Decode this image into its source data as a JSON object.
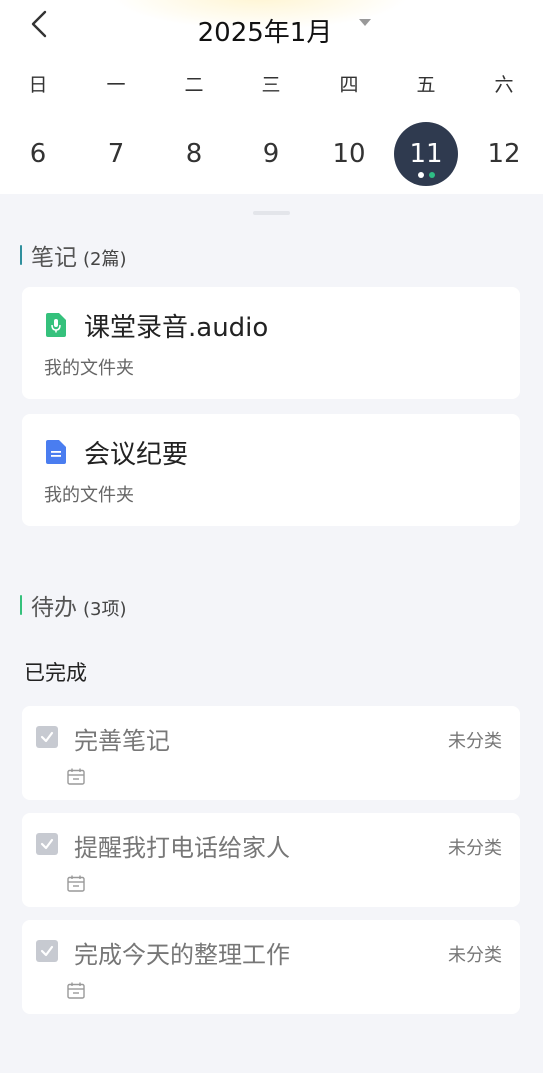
{
  "header": {
    "month_title": "2025年1月",
    "weekdays": [
      "日",
      "一",
      "二",
      "三",
      "四",
      "五",
      "六"
    ],
    "dates": [
      "6",
      "7",
      "8",
      "9",
      "10",
      "11",
      "12"
    ],
    "selected_date": "11",
    "selected_dot_colors": [
      "#ffffff",
      "#2ebd85"
    ]
  },
  "notes": {
    "title": "笔记",
    "count": "(2篇)",
    "accent": "#2f8f9d",
    "items": [
      {
        "title": "课堂录音.audio",
        "folder": "我的文件夹",
        "icon": "audio-file-icon",
        "color": "#35c17c"
      },
      {
        "title": "会议纪要",
        "folder": "我的文件夹",
        "icon": "document-file-icon",
        "color": "#4a7df0"
      }
    ]
  },
  "todos": {
    "title": "待办",
    "count": "(3项)",
    "accent": "#35c17c",
    "subhead": "已完成",
    "items": [
      {
        "title": "完善笔记",
        "category": "未分类",
        "done": true
      },
      {
        "title": "提醒我打电话给家人",
        "category": "未分类",
        "done": true
      },
      {
        "title": "完成今天的整理工作",
        "category": "未分类",
        "done": true
      }
    ]
  }
}
